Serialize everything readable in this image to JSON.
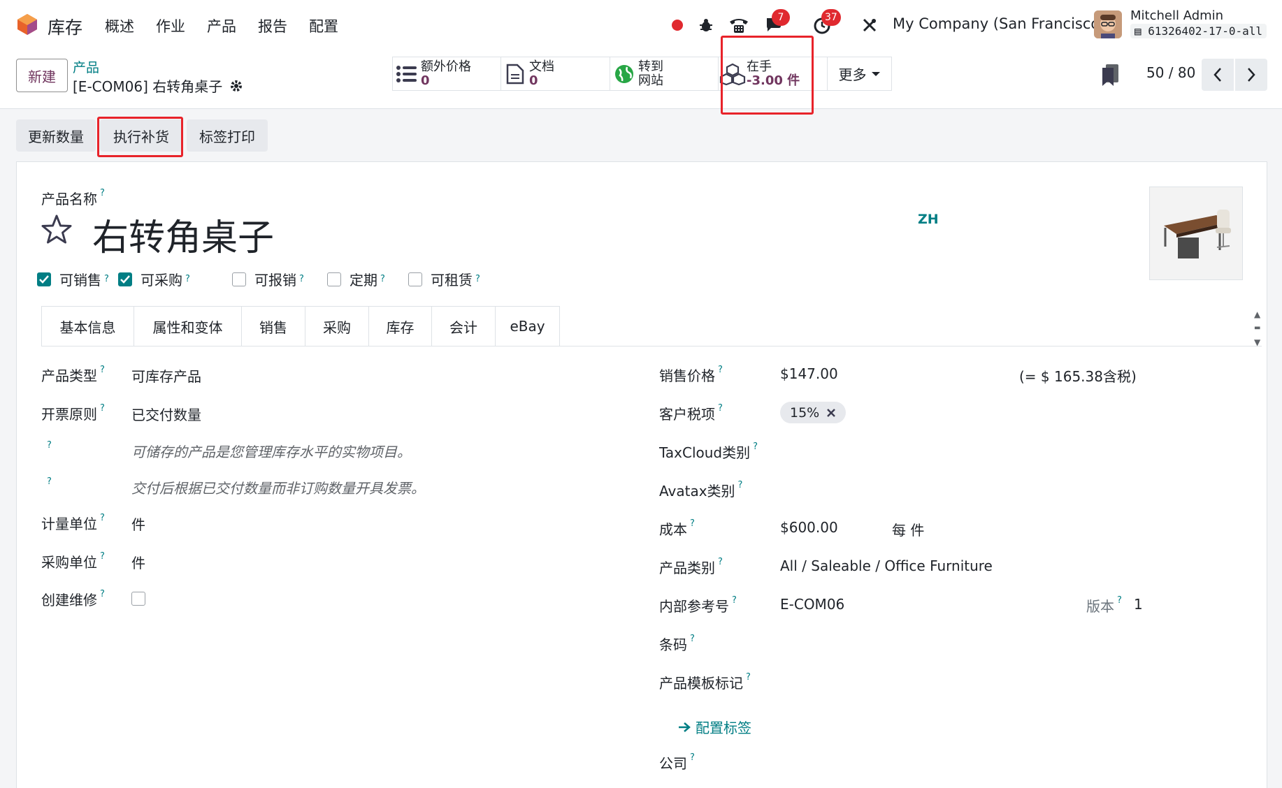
{
  "navbar": {
    "app_name": "库存",
    "menu": [
      "概述",
      "作业",
      "产品",
      "报告",
      "配置"
    ],
    "chat_badge": "7",
    "activity_badge": "37",
    "company": "My Company (San Francisco)",
    "user_name": "Mitchell Admin",
    "db_name": "61326402-17-0-all"
  },
  "control_panel": {
    "new_button": "新建",
    "breadcrumb_parent": "产品",
    "breadcrumb_current": "[E-COM06] 右转角桌子",
    "smart_buttons": [
      {
        "label": "额外价格",
        "value": "0",
        "icon": "list-icon"
      },
      {
        "label": "文档",
        "value": "0",
        "icon": "document-icon"
      },
      {
        "label": "转到",
        "value": "网站",
        "icon": "globe-icon"
      },
      {
        "label": "在手",
        "value": "-3.00 件",
        "icon": "cubes-icon"
      }
    ],
    "more_button": "更多",
    "pager": "50 / 80"
  },
  "actions": {
    "update_qty": "更新数量",
    "replenish": "执行补货",
    "print_labels": "标签打印"
  },
  "form": {
    "name_label": "产品名称",
    "name": "右转角桌子",
    "lang": "ZH",
    "checkboxes": [
      {
        "label": "可销售",
        "checked": true
      },
      {
        "label": "可采购",
        "checked": true
      },
      {
        "label": "可报销",
        "checked": false
      },
      {
        "label": "定期",
        "checked": false
      },
      {
        "label": "可租赁",
        "checked": false
      }
    ],
    "tabs": [
      "基本信息",
      "属性和变体",
      "销售",
      "采购",
      "库存",
      "会计",
      "eBay"
    ],
    "left": {
      "product_type_label": "产品类型",
      "product_type": "可库存产品",
      "invoice_policy_label": "开票原则",
      "invoice_policy": "已交付数量",
      "help_1": "可储存的产品是您管理库存水平的实物项目。",
      "help_2": "交付后根据已交付数量而非订购数量开具发票。",
      "uom_label": "计量单位",
      "uom": "件",
      "po_uom_label": "采购单位",
      "po_uom": "件",
      "repair_label": "创建维修"
    },
    "right": {
      "sale_price_label": "销售价格",
      "sale_price": "$147.00",
      "sale_price_tax": "(= $ 165.38含税)",
      "customer_tax_label": "客户税项",
      "customer_tax": "15%",
      "taxcloud_label": "TaxCloud类别",
      "avatax_label": "Avatax类别",
      "cost_label": "成本",
      "cost": "$600.00",
      "cost_unit": "每 件",
      "category_label": "产品类别",
      "category": "All / Saleable / Office Furniture",
      "ref_label": "内部参考号",
      "ref": "E-COM06",
      "version_label": "版本",
      "version": "1",
      "barcode_label": "条码",
      "template_tag_label": "产品模板标记",
      "configure_tags": "配置标签",
      "company_label": "公司"
    }
  },
  "colors": {
    "brand": "#71365f",
    "accent": "#017e84",
    "highlight": "#e8232a"
  }
}
